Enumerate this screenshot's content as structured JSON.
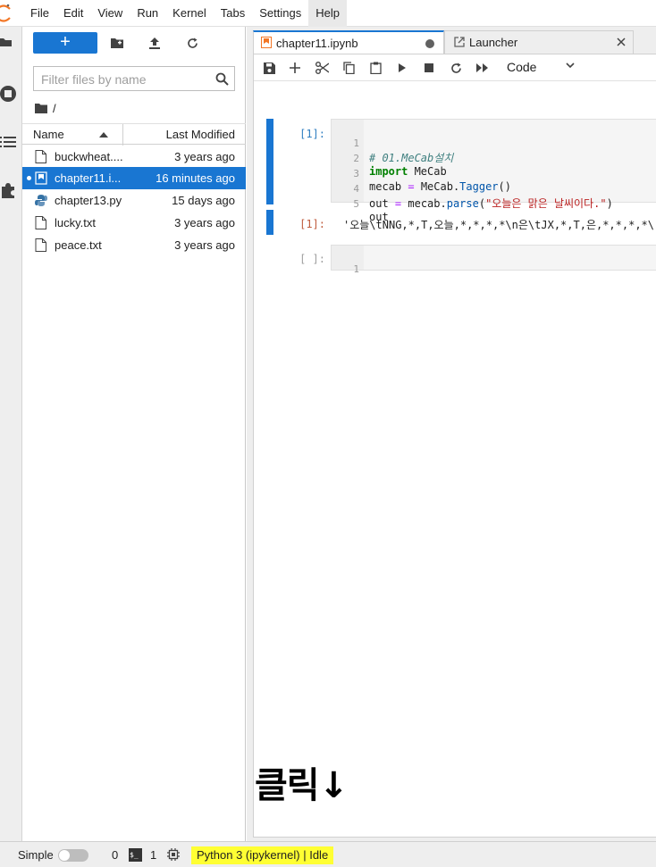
{
  "menu": [
    "File",
    "Edit",
    "View",
    "Run",
    "Kernel",
    "Tabs",
    "Settings",
    "Help"
  ],
  "filebrowser": {
    "new_label": "+",
    "filter_placeholder": "Filter files by name",
    "path": "/",
    "columns": {
      "name": "Name",
      "modified": "Last Modified"
    },
    "files": [
      {
        "name": "buckwheat....",
        "modified": "3 years ago",
        "icon": "file-icon"
      },
      {
        "name": "chapter11.i...",
        "modified": "16 minutes ago",
        "icon": "notebook-icon",
        "selected": true,
        "running": true
      },
      {
        "name": "chapter13.py",
        "modified": "15 days ago",
        "icon": "python-icon"
      },
      {
        "name": "lucky.txt",
        "modified": "3 years ago",
        "icon": "file-icon"
      },
      {
        "name": "peace.txt",
        "modified": "3 years ago",
        "icon": "file-icon"
      }
    ]
  },
  "tabs": [
    {
      "label": "chapter11.ipynb",
      "active": true,
      "modified": true
    },
    {
      "label": "Launcher",
      "active": false
    }
  ],
  "toolbar": {
    "cell_type": "Code"
  },
  "cells": {
    "cell1": {
      "prompt": "[1]:",
      "lines": [
        {
          "n": "1",
          "text": "# 01.MeCab설치"
        },
        {
          "n": "2",
          "kw": "import",
          "rest": " MeCab"
        },
        {
          "n": "3",
          "a": "mecab ",
          "op": "=",
          "b": " MeCab.",
          "attr": "Tagger",
          "c": "()"
        },
        {
          "n": "4",
          "a": "out ",
          "op": "=",
          "b": " mecab.",
          "attr": "parse",
          "c": "(",
          "str": "\"오늘은 맑은 날씨이다.\"",
          "d": ")"
        },
        {
          "n": "5",
          "text": "out"
        }
      ]
    },
    "output1": {
      "prompt": "[1]:",
      "text": "'오늘\\tNNG,*,T,오늘,*,*,*,*\\n은\\tJX,*,T,은,*,*,*,*\\"
    },
    "cell2": {
      "prompt": "[ ]:",
      "lines": [
        {
          "n": "1",
          "text": ""
        }
      ]
    }
  },
  "annotation": "클릭↓",
  "status": {
    "simple_label": "Simple",
    "terminals": "0",
    "terminal_icon_text": "$_",
    "kernels": "1",
    "kernel_status": "Python 3 (ipykernel) | Idle"
  },
  "colors": {
    "brand": "#1976d2",
    "highlight": "#ffff33",
    "orange": "#f37726"
  }
}
